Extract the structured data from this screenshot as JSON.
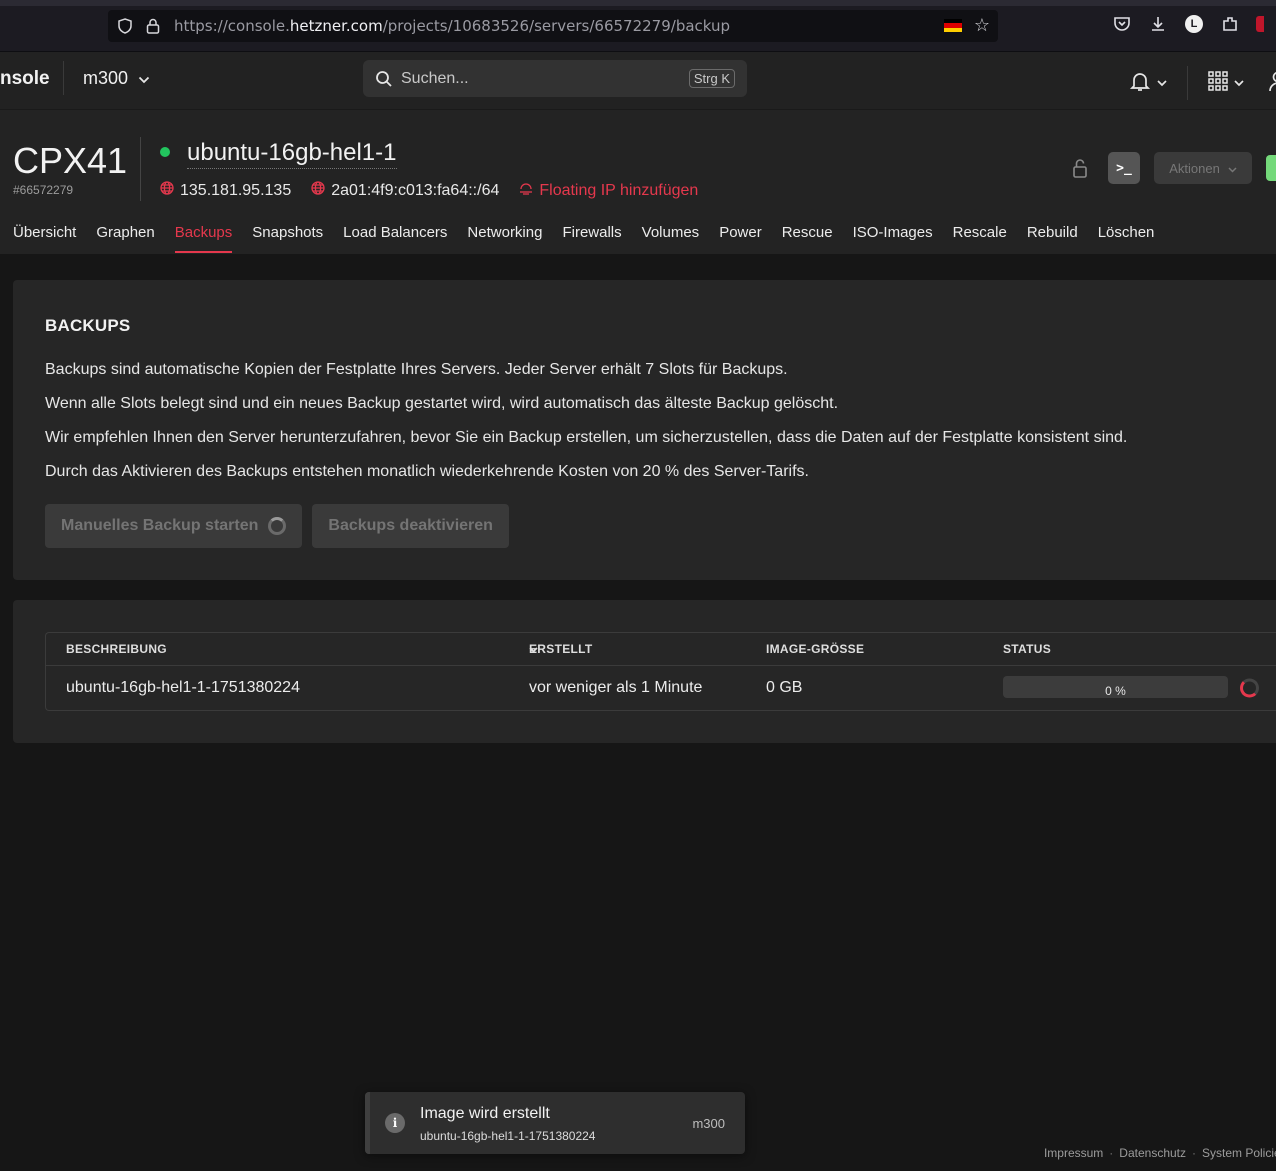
{
  "browser": {
    "url_prefix": "https://console.",
    "url_host": "hetzner.com",
    "url_path": "/projects/10683526/servers/66572279/backup",
    "profile_letter": "L"
  },
  "header": {
    "brand": "nsole",
    "project": "m300",
    "search_placeholder": "Suchen...",
    "search_shortcut": "Strg K"
  },
  "server": {
    "type": "CPX41",
    "id": "#66572279",
    "name": "ubuntu-16gb-hel1-1",
    "ipv4": "135.181.95.135",
    "ipv6": "2a01:4f9:c013:fa64::/64",
    "floating_ip": "Floating IP hinzufügen",
    "console_label": ">_",
    "actions_label": "Aktionen",
    "status_color": "#22c55e"
  },
  "tabs": [
    {
      "label": "Übersicht"
    },
    {
      "label": "Graphen"
    },
    {
      "label": "Backups",
      "active": true
    },
    {
      "label": "Snapshots"
    },
    {
      "label": "Load Balancers"
    },
    {
      "label": "Networking"
    },
    {
      "label": "Firewalls"
    },
    {
      "label": "Volumes"
    },
    {
      "label": "Power"
    },
    {
      "label": "Rescue"
    },
    {
      "label": "ISO-Images"
    },
    {
      "label": "Rescale"
    },
    {
      "label": "Rebuild"
    },
    {
      "label": "Löschen"
    }
  ],
  "backups": {
    "title": "BACKUPS",
    "lines": [
      "Backups sind automatische Kopien der Festplatte Ihres Servers. Jeder Server erhält 7 Slots für Backups.",
      "Wenn alle Slots belegt sind und ein neues Backup gestartet wird, wird automatisch das älteste Backup gelöscht.",
      "Wir empfehlen Ihnen den Server herunterzufahren, bevor Sie ein Backup erstellen, um sicherzustellen, dass die Daten auf der Festplatte konsistent sind.",
      "Durch das Aktivieren des Backups entstehen monatlich wiederkehrende Kosten von 20 % des Server-Tarifs."
    ],
    "btn_manual": "Manuelles Backup starten",
    "btn_disable": "Backups deaktivieren"
  },
  "table": {
    "columns": {
      "description": "BESCHREIBUNG",
      "created": "ERSTELLT",
      "size": "IMAGE-GRÖSSE",
      "status": "STATUS"
    },
    "rows": [
      {
        "description": "ubuntu-16gb-hel1-1-1751380224",
        "created": "vor weniger als 1 Minute",
        "size": "0 GB",
        "progress_label": "0 %",
        "progress": 0
      }
    ]
  },
  "toast": {
    "icon": "i",
    "title": "Image wird erstellt",
    "subtitle": "ubuntu-16gb-hel1-1-1751380224",
    "project": "m300"
  },
  "footer": {
    "impressum": "Impressum",
    "datenschutz": "Datenschutz",
    "policies": "System Policies",
    "sep": "·"
  },
  "colors": {
    "accent": "#e5384d",
    "status_online": "#22c55e"
  }
}
